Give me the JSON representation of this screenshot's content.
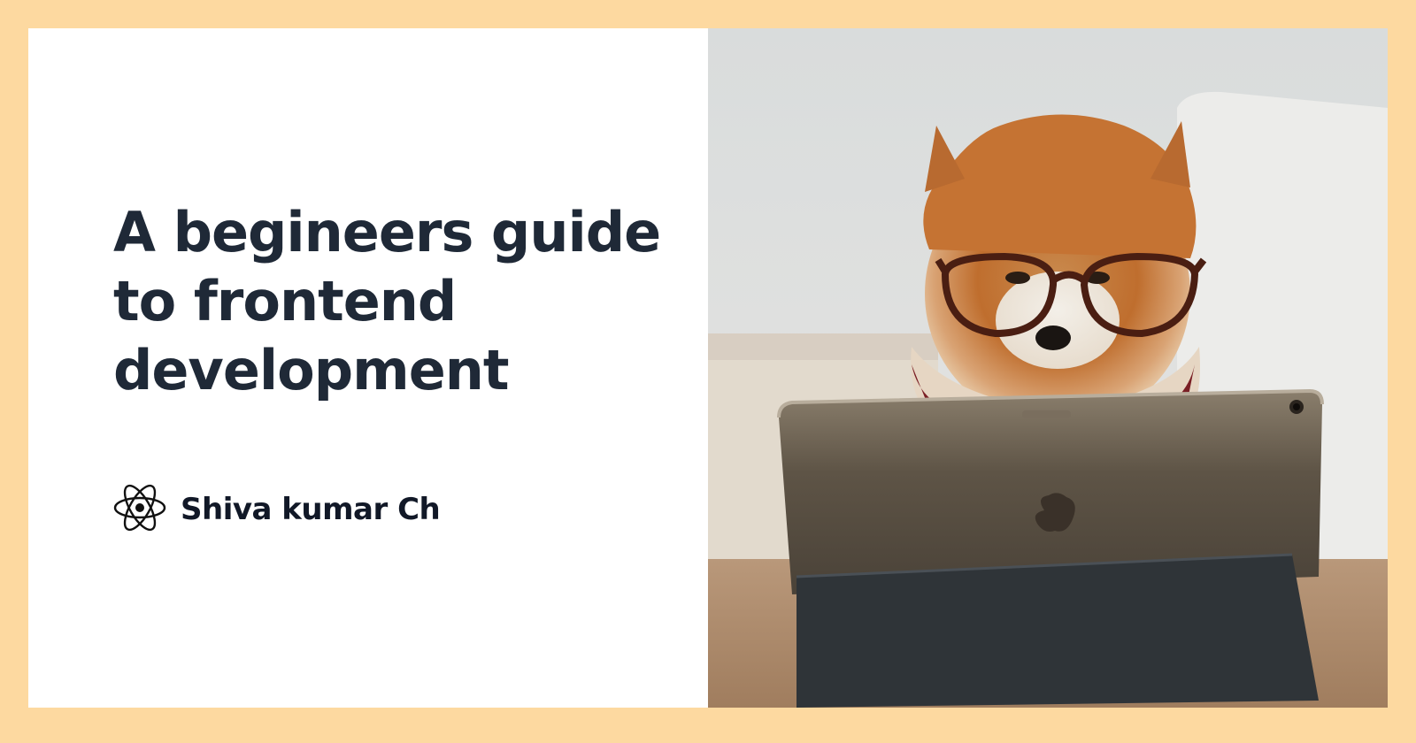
{
  "colors": {
    "frame": "#fdd9a0",
    "card": "#ffffff",
    "title": "#1f2937",
    "author": "#111827"
  },
  "article": {
    "title": "A begineers guide to frontend development"
  },
  "author": {
    "name": "Shiva kumar Ch",
    "logo_icon": "react-atom-icon"
  },
  "cover_image": {
    "subject": "pomeranian-with-glasses-tablet"
  }
}
